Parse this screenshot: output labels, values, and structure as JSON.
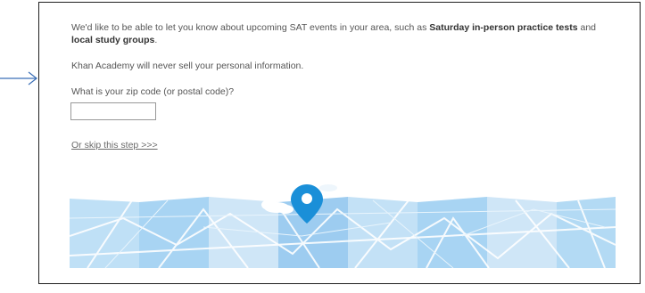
{
  "intro": {
    "text_before": "We'd like to be able to let you know about upcoming SAT events in your area, such as ",
    "bold_1": "Saturday in-person practice tests",
    "text_middle": " and ",
    "bold_2": "local study groups",
    "text_after": "."
  },
  "privacy_note": "Khan Academy will never sell your personal information.",
  "zip": {
    "label": "What is your zip code (or postal code)?",
    "value": "",
    "placeholder": ""
  },
  "skip_link": "Or skip this step >>>",
  "icons": {
    "annotation": "arrow-right-icon",
    "map_pin": "map-pin-icon",
    "cloud": "cloud-icon"
  },
  "colors": {
    "map_light": "#cfe6f7",
    "map_mid": "#9dccf0",
    "map_road": "#ffffff",
    "pin": "#1a8fd8",
    "annotation_arrow": "#3b6fb6"
  }
}
